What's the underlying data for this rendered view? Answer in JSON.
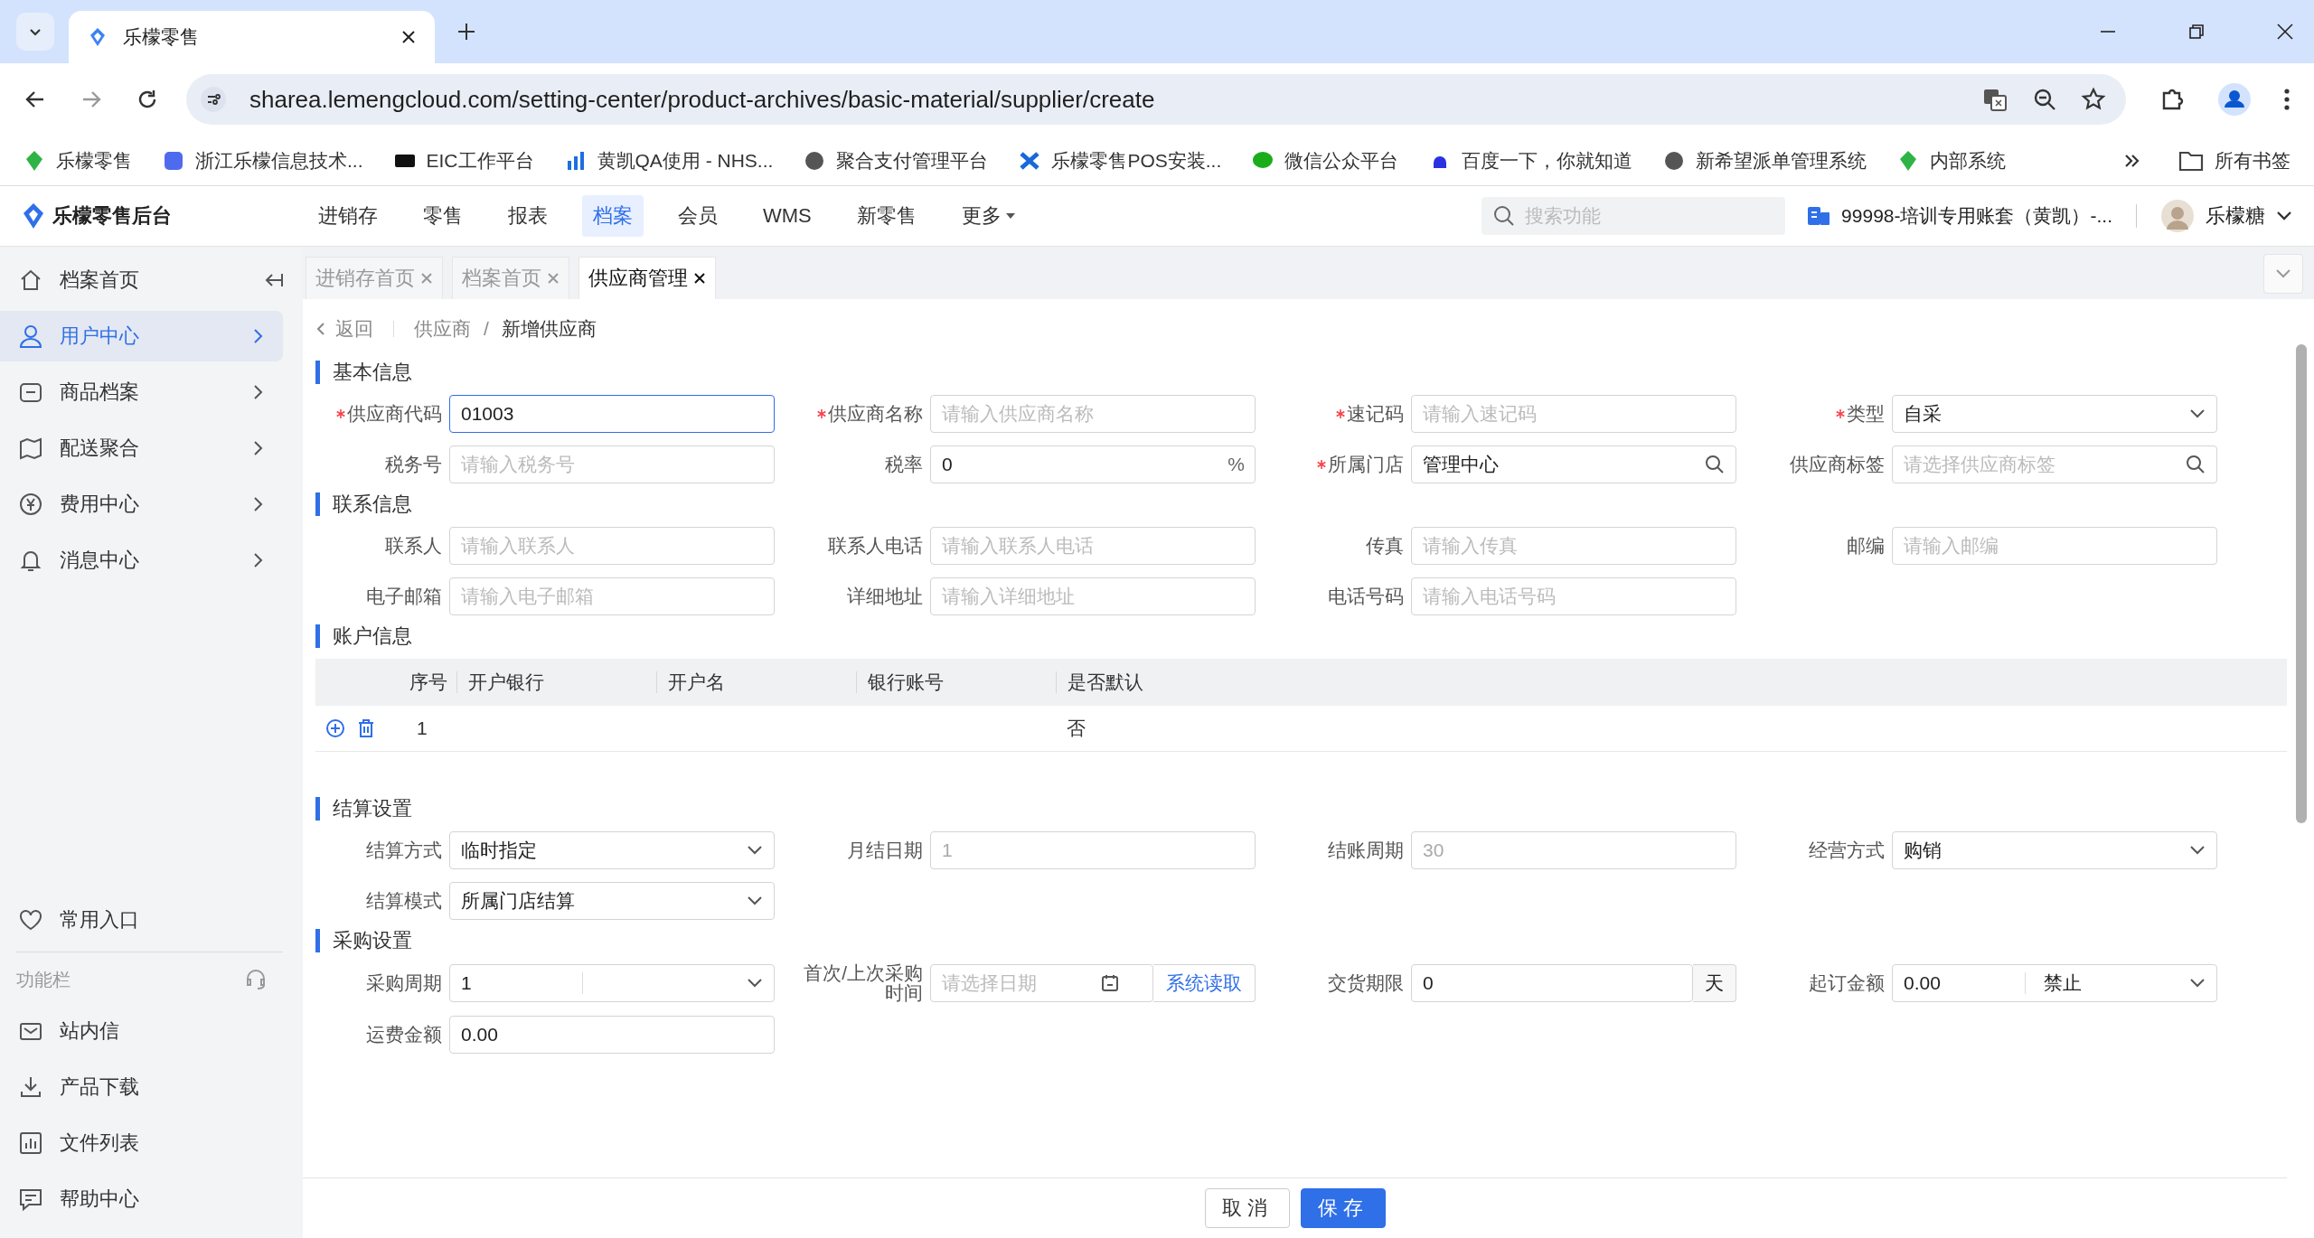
{
  "browser": {
    "tabs": [
      {
        "title": "乐檬零售",
        "selected": true
      }
    ],
    "url": "sharea.lemengcloud.com/setting-center/product-archives/basic-material/supplier/create",
    "bookmarks": [
      {
        "label": "乐檬零售"
      },
      {
        "label": "浙江乐檬信息技术..."
      },
      {
        "label": "EIC工作平台"
      },
      {
        "label": "黄凯QA使用 - NHS..."
      },
      {
        "label": "聚合支付管理平台"
      },
      {
        "label": "乐檬零售POS安装..."
      },
      {
        "label": "微信公众平台"
      },
      {
        "label": "百度一下，你就知道"
      },
      {
        "label": "新希望派单管理系统"
      },
      {
        "label": "内部系统"
      }
    ],
    "all_bookmarks": "所有书签"
  },
  "app": {
    "logo": "乐檬零售后台",
    "nav": [
      {
        "label": "进销存",
        "selected": false,
        "dropdown": false
      },
      {
        "label": "零售",
        "selected": false,
        "dropdown": false
      },
      {
        "label": "报表",
        "selected": false,
        "dropdown": false
      },
      {
        "label": "档案",
        "selected": true,
        "dropdown": false
      },
      {
        "label": "会员",
        "selected": false,
        "dropdown": false
      },
      {
        "label": "WMS",
        "selected": false,
        "dropdown": false
      },
      {
        "label": "新零售",
        "selected": false,
        "dropdown": false
      },
      {
        "label": "更多",
        "selected": false,
        "dropdown": true
      }
    ],
    "search": {
      "placeholder": "搜索功能"
    },
    "account": "99998-培训专用账套（黄凯）-...",
    "user": "乐檬糖"
  },
  "sidebar": {
    "items": [
      {
        "label": "档案首页",
        "selected": false,
        "expandable": false
      },
      {
        "label": "用户中心",
        "selected": true,
        "expandable": true
      },
      {
        "label": "商品档案",
        "selected": false,
        "expandable": true
      },
      {
        "label": "配送聚合",
        "selected": false,
        "expandable": true
      },
      {
        "label": "费用中心",
        "selected": false,
        "expandable": true
      },
      {
        "label": "消息中心",
        "selected": false,
        "expandable": true
      }
    ],
    "favorites": "常用入口",
    "tools_title": "功能栏",
    "tools": [
      {
        "label": "站内信"
      },
      {
        "label": "产品下载"
      },
      {
        "label": "文件列表"
      },
      {
        "label": "帮助中心"
      }
    ]
  },
  "page_tabs": [
    {
      "label": "进销存首页",
      "selected": false
    },
    {
      "label": "档案首页",
      "selected": false
    },
    {
      "label": "供应商管理",
      "selected": true
    }
  ],
  "breadcrumb": {
    "back": "返回",
    "separator": "/",
    "path": [
      "供应商",
      "新增供应商"
    ]
  },
  "sections": [
    {
      "title": "基本信息",
      "kind": "form",
      "fields": [
        {
          "label": "供应商代码",
          "required": true,
          "kind": "text",
          "value": "01003",
          "focused": true
        },
        {
          "label": "供应商名称",
          "required": true,
          "kind": "text",
          "placeholder": "请输入供应商名称",
          "focused": false
        },
        {
          "label": "速记码",
          "required": true,
          "kind": "text",
          "placeholder": "请输入速记码",
          "focused": false
        },
        {
          "label": "类型",
          "required": true,
          "kind": "select",
          "value": "自采",
          "focused": false
        },
        {
          "label": "税务号",
          "required": false,
          "kind": "text",
          "placeholder": "请输入税务号",
          "focused": false
        },
        {
          "label": "税率",
          "required": false,
          "kind": "suffix",
          "value": "0",
          "suffix": "%",
          "focused": false
        },
        {
          "label": "所属门店",
          "required": true,
          "kind": "search",
          "value": "管理中心",
          "focused": false
        },
        {
          "label": "供应商标签",
          "required": false,
          "kind": "search",
          "placeholder": "请选择供应商标签",
          "focused": false
        }
      ]
    },
    {
      "title": "联系信息",
      "kind": "form",
      "fields": [
        {
          "label": "联系人",
          "required": false,
          "kind": "text",
          "placeholder": "请输入联系人",
          "focused": false
        },
        {
          "label": "联系人电话",
          "required": false,
          "kind": "text",
          "placeholder": "请输入联系人电话",
          "focused": false
        },
        {
          "label": "传真",
          "required": false,
          "kind": "text",
          "placeholder": "请输入传真",
          "focused": false
        },
        {
          "label": "邮编",
          "required": false,
          "kind": "text",
          "placeholder": "请输入邮编",
          "focused": false
        },
        {
          "label": "电子邮箱",
          "required": false,
          "kind": "text",
          "placeholder": "请输入电子邮箱",
          "focused": false
        },
        {
          "label": "详细地址",
          "required": false,
          "kind": "text",
          "placeholder": "请输入详细地址",
          "focused": false
        },
        {
          "label": "电话号码",
          "required": false,
          "kind": "text",
          "placeholder": "请输入电话号码",
          "focused": false
        }
      ]
    },
    {
      "title": "账户信息",
      "kind": "table",
      "columns": [
        "序号",
        "开户银行",
        "开户名",
        "银行账号",
        "是否默认"
      ],
      "rows": [
        {
          "index": "1",
          "default": "否"
        }
      ]
    },
    {
      "title": "结算设置",
      "kind": "form",
      "fields": [
        {
          "label": "结算方式",
          "required": false,
          "kind": "select",
          "value": "临时指定",
          "focused": false
        },
        {
          "label": "月结日期",
          "required": false,
          "kind": "text",
          "value": "1",
          "disabled": true,
          "focused": false
        },
        {
          "label": "结账周期",
          "required": false,
          "kind": "text",
          "value": "30",
          "disabled": true,
          "focused": false
        },
        {
          "label": "经营方式",
          "required": false,
          "kind": "select",
          "value": "购销",
          "focused": false
        },
        {
          "label": "结算模式",
          "required": false,
          "kind": "select",
          "value": "所属门店结算",
          "focused": false
        }
      ]
    },
    {
      "title": "采购设置",
      "kind": "form",
      "fields": [
        {
          "label": "采购周期",
          "required": false,
          "kind": "split",
          "value": "1",
          "focused": false
        },
        {
          "label": "首次/上次采购时间",
          "required": false,
          "kind": "date",
          "placeholder": "请选择日期",
          "link": "系统读取",
          "focused": false
        },
        {
          "label": "交货期限",
          "required": false,
          "kind": "addon",
          "value": "0",
          "addon": "天",
          "focused": false
        },
        {
          "label": "起订金额",
          "required": false,
          "kind": "split",
          "value": "0.00",
          "option": "禁止",
          "focused": false
        },
        {
          "label": "运费金额",
          "required": false,
          "kind": "text",
          "value": "0.00",
          "focused": false
        }
      ]
    }
  ],
  "footer": [
    {
      "label": "取消",
      "kind": "default"
    },
    {
      "label": "保存",
      "kind": "primary"
    }
  ]
}
